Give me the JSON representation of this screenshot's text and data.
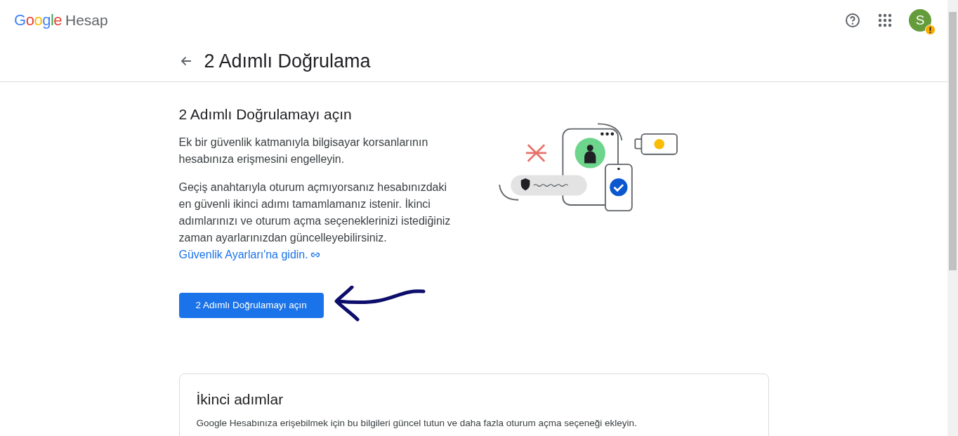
{
  "header": {
    "logo": "Google",
    "product": "Hesap",
    "avatar_letter": "S"
  },
  "page": {
    "title": "2 Adımlı Doğrulama"
  },
  "intro": {
    "heading": "2 Adımlı Doğrulamayı açın",
    "paragraph_1": "Ek bir güvenlik katmanıyla bilgisayar korsanlarının hesabınıza erişmesini engelleyin.",
    "paragraph_2": "Geçiş anahtarıyla oturum açmıyorsanız hesabınızdaki en güvenli ikinci adımı tamamlamanız istenir. İkinci adımlarınızı ve oturum açma seçeneklerinizi istediğiniz zaman ayarlarınızdan güncelleyebilirsiniz.",
    "link": "Güvenlik Ayarları'na gidin.",
    "button": "2 Adımlı Doğrulamayı açın"
  },
  "card": {
    "title": "İkinci adımlar",
    "description": "Google Hesabınıza erişebilmek için bu bilgileri güncel tutun ve daha fazla oturum açma seçeneği ekleyin."
  }
}
